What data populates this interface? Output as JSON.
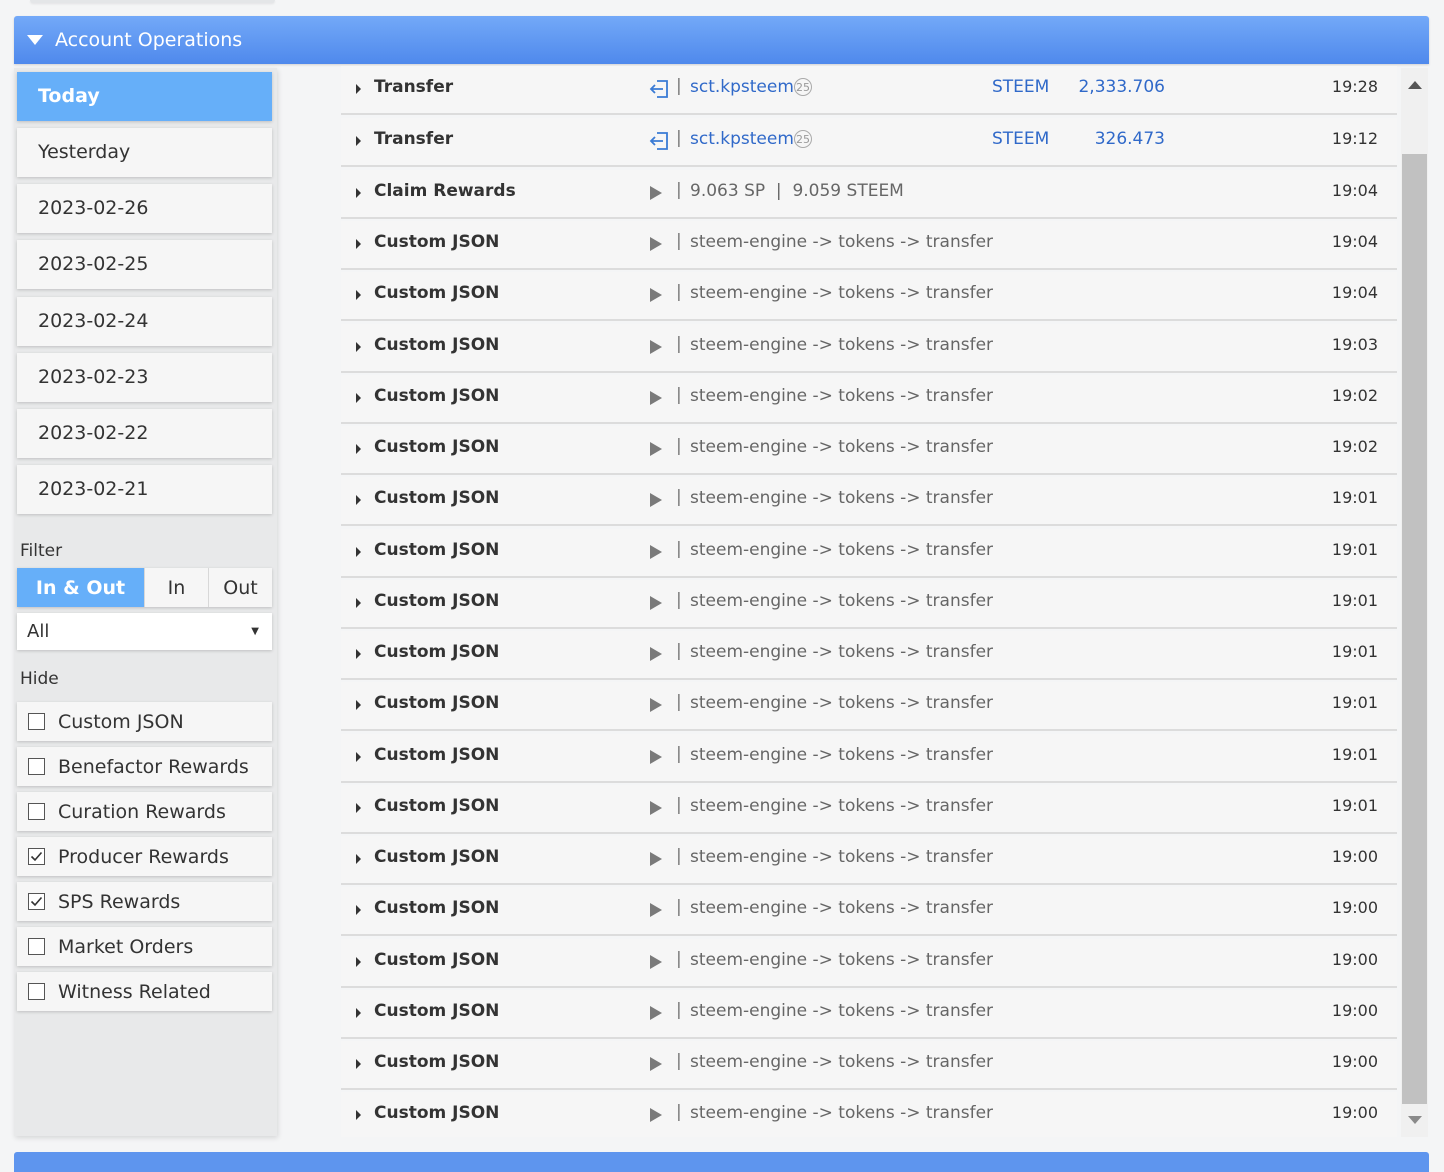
{
  "panel": {
    "title": "Account Operations"
  },
  "sidebar": {
    "dates": [
      "Today",
      "Yesterday",
      "2023-02-26",
      "2023-02-25",
      "2023-02-24",
      "2023-02-23",
      "2023-02-22",
      "2023-02-21"
    ],
    "active_date": "Today",
    "filter_label": "Filter",
    "direction": {
      "options": [
        "In & Out",
        "In",
        "Out"
      ],
      "selected": "In & Out"
    },
    "type_select": {
      "value": "All"
    },
    "hide_label": "Hide",
    "hide_options": [
      {
        "label": "Custom JSON",
        "checked": false
      },
      {
        "label": "Benefactor Rewards",
        "checked": false
      },
      {
        "label": "Curation Rewards",
        "checked": false
      },
      {
        "label": "Producer Rewards",
        "checked": true
      },
      {
        "label": "SPS Rewards",
        "checked": true
      },
      {
        "label": "Market Orders",
        "checked": false
      },
      {
        "label": "Witness Related",
        "checked": false
      }
    ]
  },
  "operations": [
    {
      "type": "Transfer",
      "icon": "incoming-transfer-icon",
      "account": "sct.kpsteem",
      "reputation": "25",
      "asset": "STEEM",
      "amount": "2,333.706",
      "time": "19:28"
    },
    {
      "type": "Transfer",
      "icon": "incoming-transfer-icon",
      "account": "sct.kpsteem",
      "reputation": "25",
      "asset": "STEEM",
      "amount": "326.473",
      "time": "19:12"
    },
    {
      "type": "Claim Rewards",
      "icon": "play-icon",
      "detail": "9.063 SP  |  9.059 STEEM",
      "time": "19:04"
    },
    {
      "type": "Custom JSON",
      "icon": "play-icon",
      "detail": "steem-engine -> tokens -> transfer",
      "time": "19:04"
    },
    {
      "type": "Custom JSON",
      "icon": "play-icon",
      "detail": "steem-engine -> tokens -> transfer",
      "time": "19:04"
    },
    {
      "type": "Custom JSON",
      "icon": "play-icon",
      "detail": "steem-engine -> tokens -> transfer",
      "time": "19:03"
    },
    {
      "type": "Custom JSON",
      "icon": "play-icon",
      "detail": "steem-engine -> tokens -> transfer",
      "time": "19:02"
    },
    {
      "type": "Custom JSON",
      "icon": "play-icon",
      "detail": "steem-engine -> tokens -> transfer",
      "time": "19:02"
    },
    {
      "type": "Custom JSON",
      "icon": "play-icon",
      "detail": "steem-engine -> tokens -> transfer",
      "time": "19:01"
    },
    {
      "type": "Custom JSON",
      "icon": "play-icon",
      "detail": "steem-engine -> tokens -> transfer",
      "time": "19:01"
    },
    {
      "type": "Custom JSON",
      "icon": "play-icon",
      "detail": "steem-engine -> tokens -> transfer",
      "time": "19:01"
    },
    {
      "type": "Custom JSON",
      "icon": "play-icon",
      "detail": "steem-engine -> tokens -> transfer",
      "time": "19:01"
    },
    {
      "type": "Custom JSON",
      "icon": "play-icon",
      "detail": "steem-engine -> tokens -> transfer",
      "time": "19:01"
    },
    {
      "type": "Custom JSON",
      "icon": "play-icon",
      "detail": "steem-engine -> tokens -> transfer",
      "time": "19:01"
    },
    {
      "type": "Custom JSON",
      "icon": "play-icon",
      "detail": "steem-engine -> tokens -> transfer",
      "time": "19:01"
    },
    {
      "type": "Custom JSON",
      "icon": "play-icon",
      "detail": "steem-engine -> tokens -> transfer",
      "time": "19:00"
    },
    {
      "type": "Custom JSON",
      "icon": "play-icon",
      "detail": "steem-engine -> tokens -> transfer",
      "time": "19:00"
    },
    {
      "type": "Custom JSON",
      "icon": "play-icon",
      "detail": "steem-engine -> tokens -> transfer",
      "time": "19:00"
    },
    {
      "type": "Custom JSON",
      "icon": "play-icon",
      "detail": "steem-engine -> tokens -> transfer",
      "time": "19:00"
    },
    {
      "type": "Custom JSON",
      "icon": "play-icon",
      "detail": "steem-engine -> tokens -> transfer",
      "time": "19:00"
    },
    {
      "type": "Custom JSON",
      "icon": "play-icon",
      "detail": "steem-engine -> tokens -> transfer",
      "time": "19:00"
    }
  ],
  "colors": {
    "header": "#5b93f0",
    "active": "#66aff9",
    "link": "#3069c9"
  }
}
